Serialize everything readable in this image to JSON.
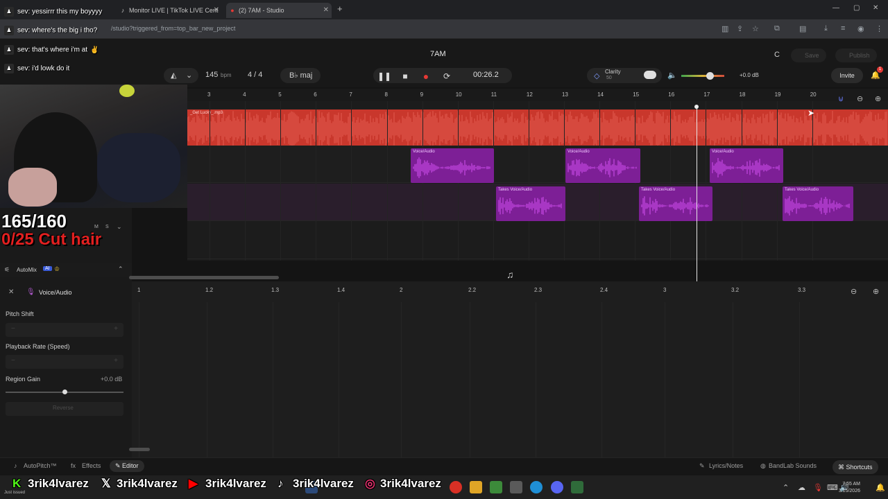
{
  "browser": {
    "tabs": [
      {
        "label": "Monitor LIVE | TikTok LIVE Cent"
      },
      {
        "label": "(2) 7AM - Studio"
      }
    ],
    "url": "/studio?triggered_from=top_bar_new_project"
  },
  "chat": [
    {
      "text": "sev: yessirrr this my boyyyy"
    },
    {
      "text": "sev: where's the big i tho?"
    },
    {
      "text": "sev: that's where i'm at"
    },
    {
      "text": "sev: i'd lowk do it"
    }
  ],
  "app": {
    "project_title": "7AM",
    "bpm_value": "145",
    "bpm_unit": "bpm",
    "time_signature": "4 / 4",
    "key": "B♭ maj",
    "time": "00:26.2",
    "clarity_label": "Clarity",
    "clarity_value": "50",
    "volume_db": "+0.0 dB",
    "invite_label": "Invite",
    "notif_count": "1",
    "save_label": "Save",
    "publish_label": "Publish",
    "c_letter": "C"
  },
  "ruler": [
    "3",
    "4",
    "5",
    "6",
    "7",
    "8",
    "9",
    "10",
    "11",
    "12",
    "13",
    "14",
    "15",
    "16",
    "17",
    "18",
    "19",
    "20"
  ],
  "tracks": {
    "song_label": "_Get Lucky_.mp3",
    "clip_label": "Voice/Audio",
    "takes_label": "Takes"
  },
  "overlay": {
    "counter": "165/160",
    "goal": "0/25 Cut hair",
    "handle": "3rik4lvarez"
  },
  "left_panel": {
    "automix": "AutoMix",
    "automix_badge": "AI",
    "track_name": "Voice/Audio",
    "m": "M",
    "s": "S"
  },
  "editor": {
    "ruler": [
      "1",
      "1.2",
      "1.3",
      "1.4",
      "2",
      "2.2",
      "2.3",
      "2.4",
      "3",
      "3.2",
      "3.3"
    ],
    "pitch_shift": "Pitch Shift",
    "playback_rate": "Playback Rate (Speed)",
    "region_gain": "Region Gain",
    "region_gain_value": "+0.0 dB",
    "reverse": "Reverse",
    "minus": "−",
    "plus": "+"
  },
  "bottom": {
    "autopitch": "AutoPitch™",
    "effects": "Effects",
    "editor": "Editor",
    "lyrics": "Lyrics/Notes",
    "sounds": "BandLab Sounds",
    "shortcuts": "Shortcuts"
  },
  "taskbar": {
    "time": "7:55 AM",
    "date": "3/15/2026",
    "notice": "Just issued"
  },
  "colors": {
    "song": "#c9372c",
    "clip": "#7d1f96",
    "accent_red": "#e53935"
  }
}
